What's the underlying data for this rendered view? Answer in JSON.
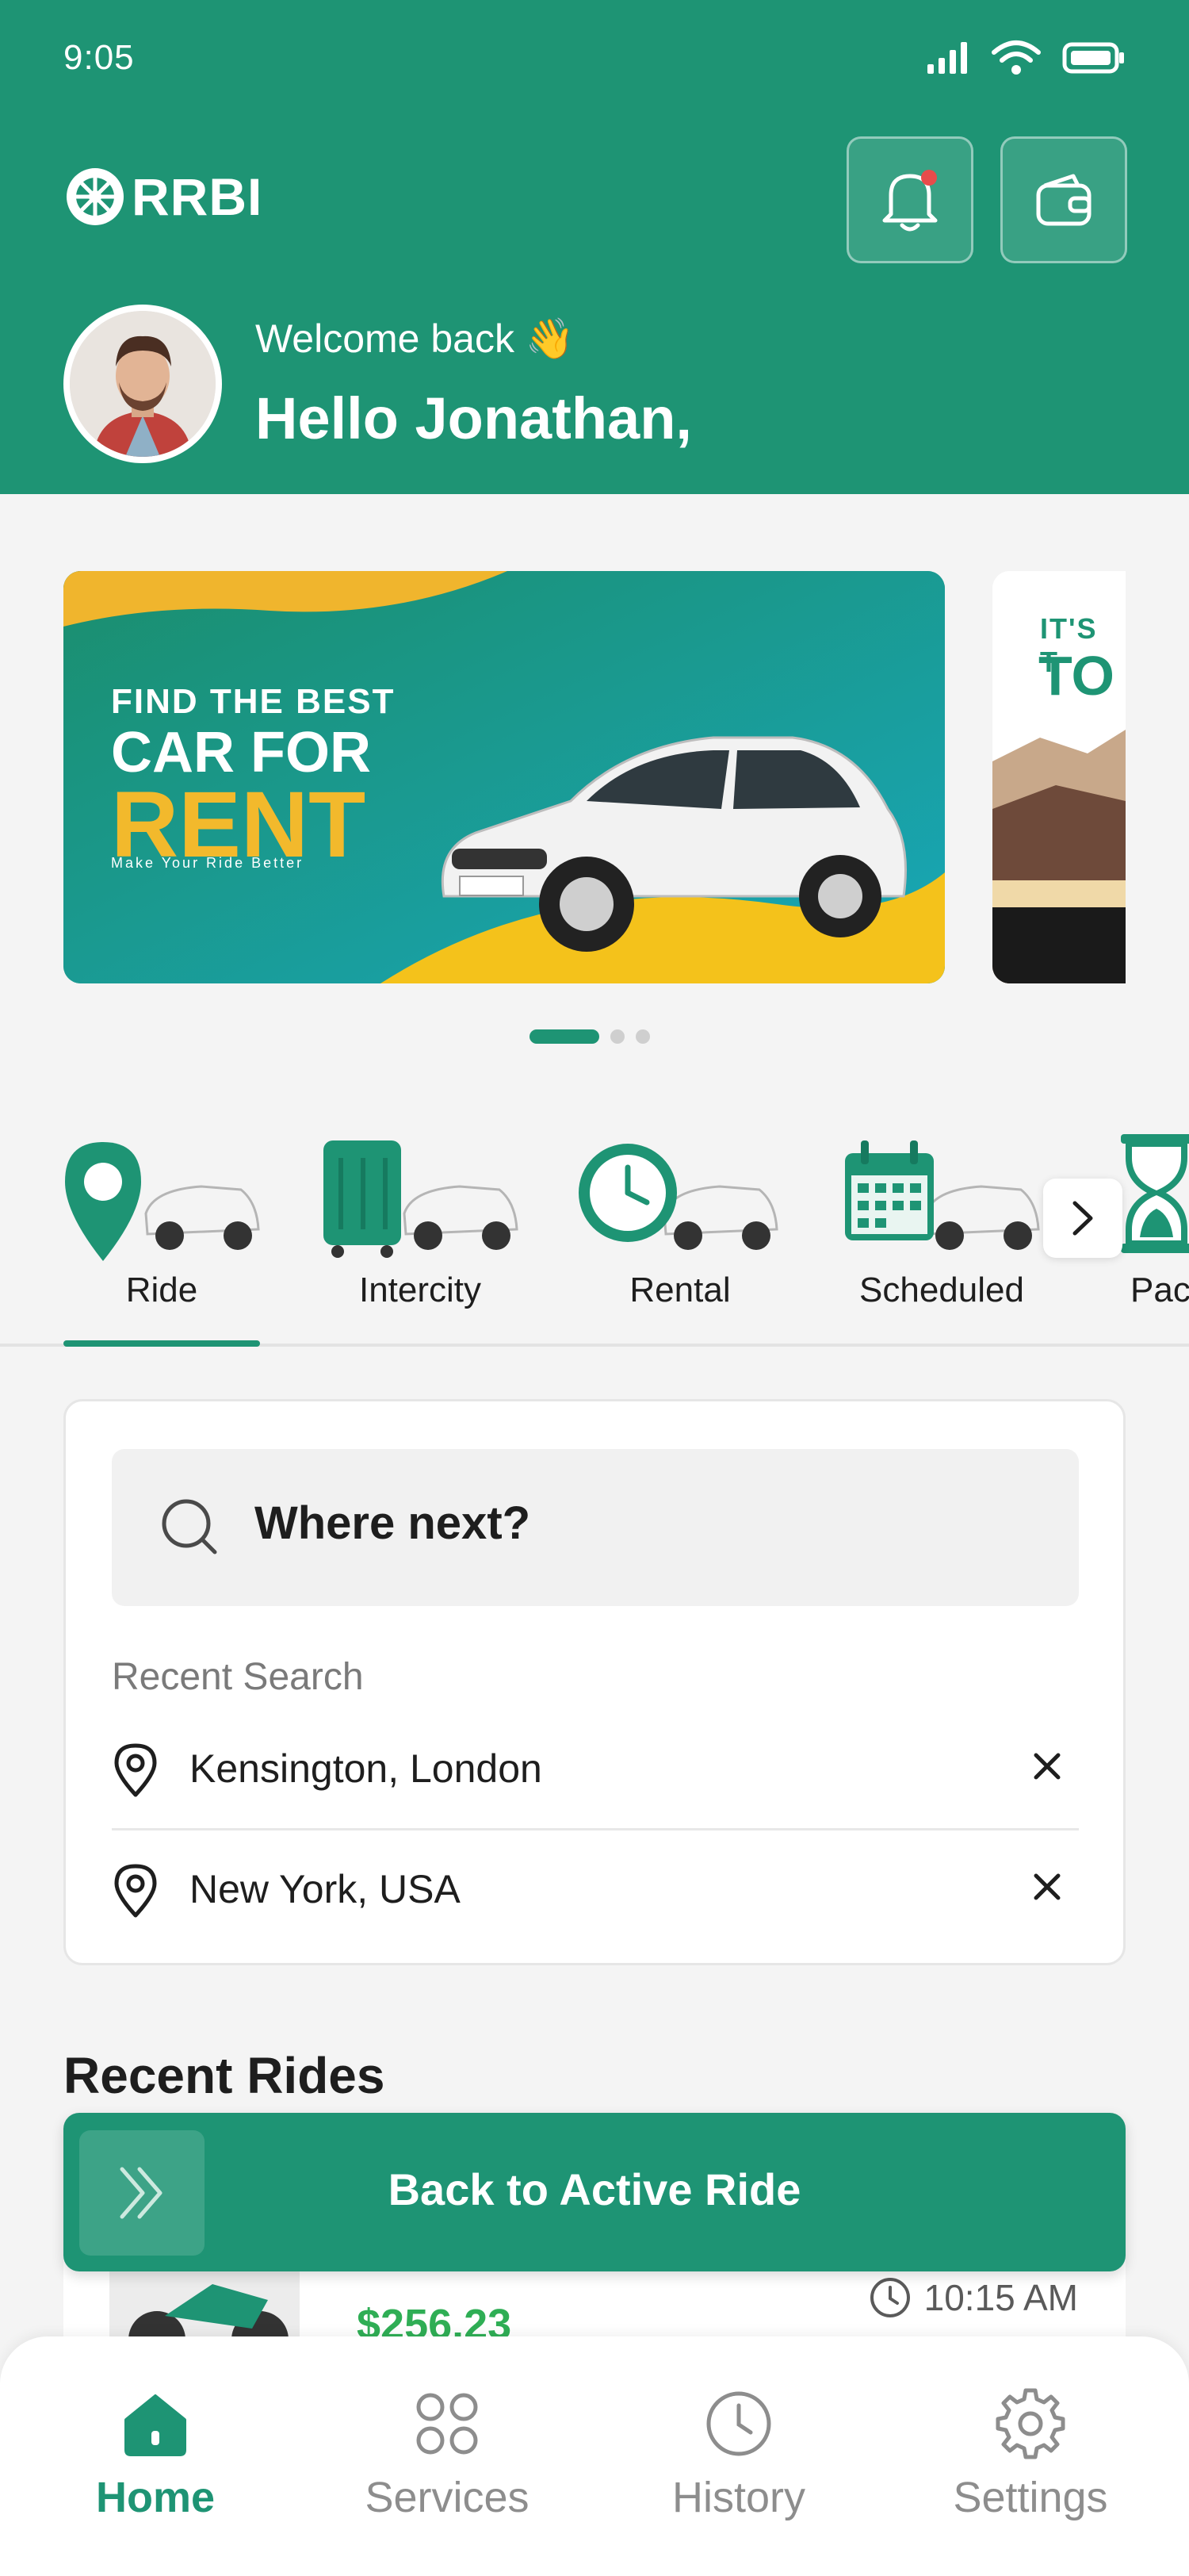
{
  "status_bar": {
    "time": "9:05"
  },
  "header": {
    "logo_text": "RRBI",
    "welcome": "Welcome back 👋",
    "greeting": "Hello Jonathan,"
  },
  "banner": {
    "line1": "FIND THE BEST",
    "line2": "CAR FOR",
    "line3": "RENT",
    "tagline": "Make Your Ride Better",
    "next_banner_line1": "IT'S T",
    "next_banner_line2": "TO"
  },
  "categories": [
    {
      "label": "Ride",
      "icon": "map-pin-car"
    },
    {
      "label": "Intercity",
      "icon": "luggage-car"
    },
    {
      "label": "Rental",
      "icon": "clock-car"
    },
    {
      "label": "Scheduled",
      "icon": "calendar-car"
    },
    {
      "label": "Pac",
      "icon": "hourglass-car"
    }
  ],
  "search": {
    "placeholder": "Where next?",
    "recent_label": "Recent Search",
    "recent": [
      {
        "text": "Kensington, London"
      },
      {
        "text": "New York, USA"
      }
    ]
  },
  "recent_rides": {
    "title": "Recent Rides",
    "peek": {
      "price": "$256.23",
      "time": "10:15 AM"
    }
  },
  "active_ride": {
    "label": "Back to Active Ride"
  },
  "nav": [
    {
      "label": "Home",
      "active": true
    },
    {
      "label": "Services",
      "active": false
    },
    {
      "label": "History",
      "active": false
    },
    {
      "label": "Settings",
      "active": false
    }
  ],
  "colors": {
    "primary": "#1e9474",
    "accent_yellow": "#f2b92c",
    "price_green": "#2fae55",
    "notification_dot": "#e84b4b"
  }
}
